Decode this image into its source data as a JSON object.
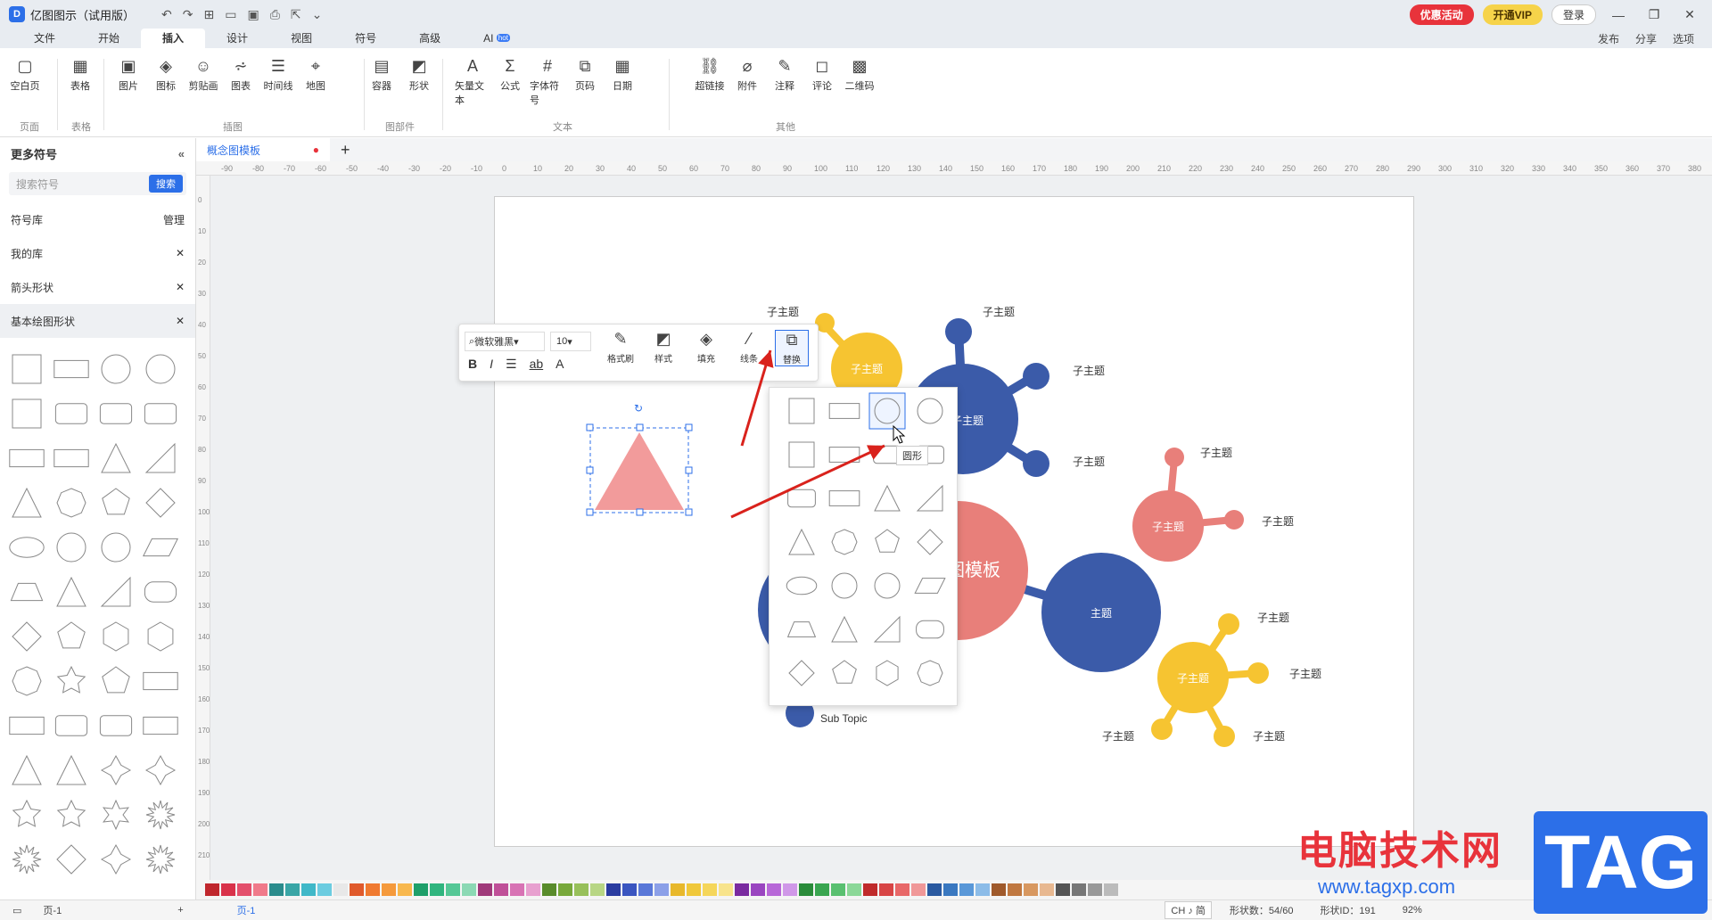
{
  "app": {
    "title": "亿图图示（试用版）",
    "logo": "D"
  },
  "titlebar": {
    "promo": "优惠活动",
    "vip": "开通VIP",
    "login": "登录"
  },
  "menus": [
    "文件",
    "开始",
    "插入",
    "设计",
    "视图",
    "符号",
    "高级"
  ],
  "ai": {
    "label": "AI",
    "badge": "hot"
  },
  "menu_right": [
    "发布",
    "分享",
    "选项"
  ],
  "ribbon": {
    "page": [
      {
        "icon": "▢",
        "label": "空白页"
      }
    ],
    "table": [
      {
        "icon": "▦",
        "label": "表格"
      }
    ],
    "illus": [
      {
        "icon": "▣",
        "label": "图片"
      },
      {
        "icon": "◈",
        "label": "图标"
      },
      {
        "icon": "☺",
        "label": "剪贴画"
      },
      {
        "icon": "⩫",
        "label": "图表"
      },
      {
        "icon": "☰",
        "label": "时间线"
      },
      {
        "icon": "⌖",
        "label": "地图"
      }
    ],
    "parts": [
      {
        "icon": "▤",
        "label": "容器"
      },
      {
        "icon": "◩",
        "label": "形状"
      }
    ],
    "text": [
      {
        "icon": "A",
        "label": "矢量文本"
      },
      {
        "icon": "Σ",
        "label": "公式"
      },
      {
        "icon": "#",
        "label": "字体符号"
      },
      {
        "icon": "⧉",
        "label": "页码"
      },
      {
        "icon": "▦",
        "label": "日期"
      }
    ],
    "other": [
      {
        "icon": "⛓",
        "label": "超链接"
      },
      {
        "icon": "⌀",
        "label": "附件"
      },
      {
        "icon": "✎",
        "label": "注释"
      },
      {
        "icon": "◻",
        "label": "评论"
      },
      {
        "icon": "▩",
        "label": "二维码"
      }
    ],
    "groups": [
      "页面",
      "表格",
      "插图",
      "图部件",
      "文本",
      "其他"
    ]
  },
  "sidebar": {
    "header": "更多符号",
    "search_placeholder": "搜索符号",
    "search_button": "搜索",
    "library": "符号库",
    "manage": "管理",
    "items": [
      "我的库",
      "箭头形状",
      "基本绘图形状"
    ]
  },
  "tab": {
    "title": "概念图模板"
  },
  "ruler": [
    "-90",
    "-80",
    "-70",
    "-60",
    "-50",
    "-40",
    "-30",
    "-20",
    "-10",
    "0",
    "10",
    "20",
    "30",
    "40",
    "50",
    "60",
    "70",
    "80",
    "90",
    "100",
    "110",
    "120",
    "130",
    "140",
    "150",
    "160",
    "170",
    "180",
    "190",
    "200",
    "210",
    "220",
    "230",
    "240",
    "250",
    "260",
    "270",
    "280",
    "290",
    "300",
    "310",
    "320",
    "330",
    "340",
    "350",
    "360",
    "370",
    "380"
  ],
  "vruler": [
    "0",
    "10",
    "20",
    "30",
    "40",
    "50",
    "60",
    "70",
    "80",
    "90",
    "100",
    "110",
    "120",
    "130",
    "140",
    "150",
    "160",
    "170",
    "180",
    "190",
    "200",
    "210"
  ],
  "floatbar": {
    "font": "微软雅黑",
    "size": "10",
    "tools": [
      "格式刷",
      "样式",
      "填充",
      "线条",
      "替换"
    ]
  },
  "tooltip": "圆形",
  "diagram": {
    "center": "图模板",
    "main": "主题",
    "subtopic": "子主题",
    "sub_en": "Sub Topic"
  },
  "status": {
    "page": "页-1",
    "page_tab": "页-1",
    "shapes": "形状数：54/60",
    "shape_id": "形状ID：191",
    "zoom": "92%",
    "ime": "CH ♪ 简"
  },
  "watermark": {
    "cn": "电脑技术网",
    "url": "www.tagxp.com",
    "tag": "TAG"
  },
  "colors": {
    "accent": "#2c6fe8",
    "navy": "#3b5ba9",
    "yellow": "#f6c431",
    "salmon": "#e87f7a",
    "pink": "#f29b9b"
  }
}
